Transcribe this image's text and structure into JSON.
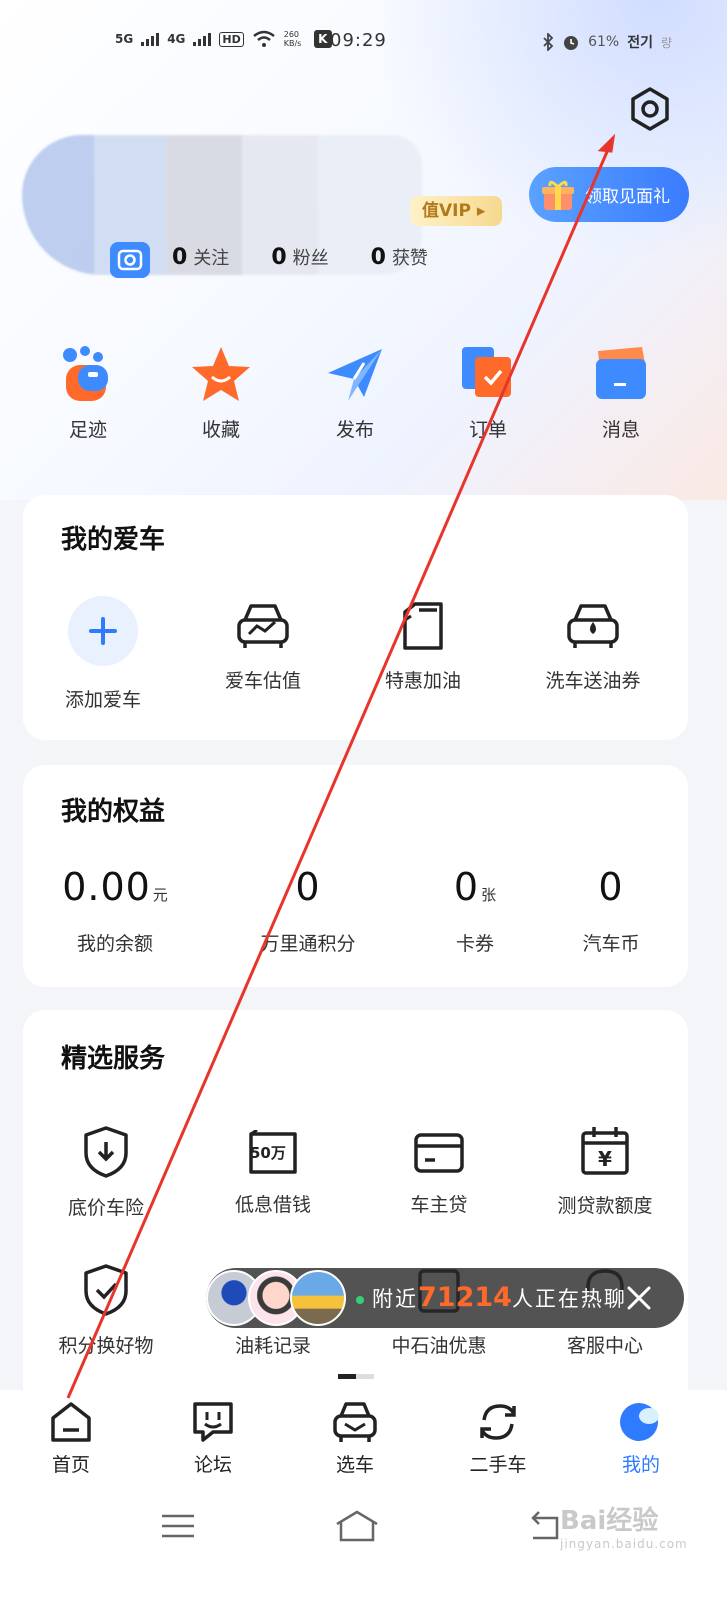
{
  "status_bar": {
    "net1": "5G",
    "net2": "4G",
    "hd": "HD",
    "speed": "260 KB/s",
    "time": "09:29",
    "battery": "61%",
    "charging_text": "전기",
    "charging_icon_text": "량"
  },
  "profile": {
    "vip_label": "值VIP",
    "follow_count": "0",
    "follow_label": "关注",
    "fans_count": "0",
    "fans_label": "粉丝",
    "likes_count": "0",
    "likes_label": "获赞",
    "gift_button": "领取见面礼"
  },
  "quick_actions": [
    {
      "label": "足迹",
      "icon": "footprint-icon"
    },
    {
      "label": "收藏",
      "icon": "star-icon"
    },
    {
      "label": "发布",
      "icon": "paper-plane-icon"
    },
    {
      "label": "订单",
      "icon": "order-icon"
    },
    {
      "label": "消息",
      "icon": "message-icon"
    }
  ],
  "my_car": {
    "title": "我的爱车",
    "items": [
      {
        "label": "添加爱车",
        "icon": "plus-icon"
      },
      {
        "label": "爱车估值",
        "icon": "car-valuation-icon"
      },
      {
        "label": "特惠加油",
        "icon": "fuel-can-icon"
      },
      {
        "label": "洗车送油券",
        "icon": "car-wash-icon"
      }
    ]
  },
  "benefits": {
    "title": "我的权益",
    "items": [
      {
        "value": "0.00",
        "unit": "元",
        "label": "我的余额"
      },
      {
        "value": "0",
        "unit": "",
        "label": "万里通积分"
      },
      {
        "value": "0",
        "unit": "张",
        "label": "卡券"
      },
      {
        "value": "0",
        "unit": "",
        "label": "汽车币"
      }
    ]
  },
  "services": {
    "title": "精选服务",
    "items": [
      {
        "label": "底价车险",
        "icon": "shield-download-icon"
      },
      {
        "label": "低息借钱",
        "icon": "loan-50wan-icon",
        "icon_text": "50万"
      },
      {
        "label": "车主贷",
        "icon": "card-icon"
      },
      {
        "label": "测贷款额度",
        "icon": "calendar-yuan-icon",
        "icon_text": "¥"
      },
      {
        "label": "积分换好物",
        "icon": "shield-check-icon"
      },
      {
        "label": "油耗记录",
        "icon": "fuel-record-icon"
      },
      {
        "label": "中石油优惠",
        "icon": "gas-station-icon"
      },
      {
        "label": "客服中心",
        "icon": "headset-icon"
      }
    ]
  },
  "chat_banner": {
    "prefix": "附近",
    "count": "71214",
    "suffix": "人正在热聊"
  },
  "tabbar": [
    {
      "label": "首页",
      "icon": "home-icon"
    },
    {
      "label": "论坛",
      "icon": "forum-icon"
    },
    {
      "label": "选车",
      "icon": "car-select-icon"
    },
    {
      "label": "二手车",
      "icon": "refresh-icon"
    },
    {
      "label": "我的",
      "icon": "profile-blob-icon",
      "active": true
    }
  ],
  "watermark": {
    "main": "Bai经验",
    "sub": "jingyan.baidu.com"
  },
  "colors": {
    "accent": "#2f7bff",
    "orange": "#ff6a2b",
    "annotation": "#e8342a"
  }
}
